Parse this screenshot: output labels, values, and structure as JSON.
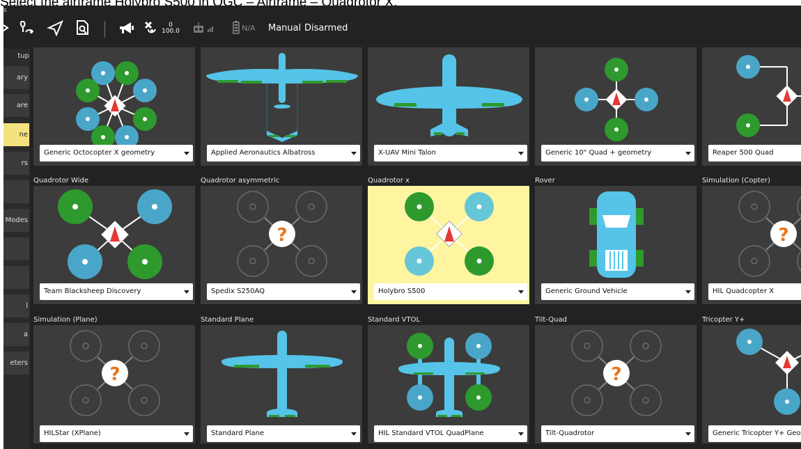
{
  "instruction": "Select the airframe Holybro S500 in QGC – Airframe – Quadrotor X.",
  "toolbar": {
    "top_fragment": "s",
    "sat_count": "0",
    "sat_hdop": "100.0",
    "battery": "N/A",
    "flight_mode": "Manual",
    "arm_status": "Disarmed"
  },
  "sidebar": {
    "items": [
      {
        "label": "tup"
      },
      {
        "label": "ary"
      },
      {
        "label": "are"
      },
      {
        "label": "ne"
      },
      {
        "label": "rs"
      },
      {
        "label": ""
      },
      {
        "label": "Modes"
      },
      {
        "label": ""
      },
      {
        "label": ""
      },
      {
        "label": "l"
      },
      {
        "label": "a"
      },
      {
        "label": "eters"
      }
    ]
  },
  "rows": [
    {
      "categories": [
        "",
        "",
        "",
        "",
        ""
      ],
      "tiles": [
        {
          "selected": "Generic Octocopter X geometry",
          "icon": "octocopter-x-diagram"
        },
        {
          "selected": "Applied Aeronautics Albatross",
          "icon": "plane-vtail-diagram"
        },
        {
          "selected": "X-UAV Mini Talon",
          "icon": "flying-wing-diagram"
        },
        {
          "selected": "Generic 10\" Quad + geometry",
          "icon": "quad-plus-diagram"
        },
        {
          "selected": "Reaper 500 Quad",
          "icon": "quad-h-diagram"
        }
      ]
    },
    {
      "categories": [
        "Quadrotor Wide",
        "Quadrotor asymmetric",
        "Quadrotor x",
        "Rover",
        "Simulation (Copter)"
      ],
      "tiles": [
        {
          "selected": "Team Blacksheep Discovery",
          "icon": "quad-wide-diagram"
        },
        {
          "selected": "Spedix S250AQ",
          "icon": "unknown-airframe-icon"
        },
        {
          "selected": "Holybro S500",
          "icon": "quad-x-diagram"
        },
        {
          "selected": "Generic Ground Vehicle",
          "icon": "rover-car-diagram"
        },
        {
          "selected": "HIL Quadcopter X",
          "icon": "unknown-airframe-icon"
        }
      ]
    },
    {
      "categories": [
        "Simulation (Plane)",
        "Standard Plane",
        "Standard VTOL",
        "Tilt-Quad",
        "Tricopter Y+"
      ],
      "tiles": [
        {
          "selected": "HILStar (XPlane)",
          "icon": "unknown-airframe-icon"
        },
        {
          "selected": "Standard Plane",
          "icon": "standard-plane-diagram"
        },
        {
          "selected": "HIL Standard VTOL QuadPlane",
          "icon": "vtol-quadplane-diagram"
        },
        {
          "selected": "Tilt-Quadrotor",
          "icon": "unknown-airframe-icon"
        },
        {
          "selected": "Generic Tricopter Y+ Geometry",
          "icon": "tricopter-y-diagram"
        }
      ]
    }
  ],
  "colors": {
    "green_prop": "#2e9a2e",
    "blue_prop": "#4aa6c8",
    "light_blue_prop": "#66c6d8",
    "plane_body": "#55c4e8",
    "selected_tile": "#fff5a0",
    "accent_red": "#e53935",
    "question_orange": "#e8761c"
  }
}
